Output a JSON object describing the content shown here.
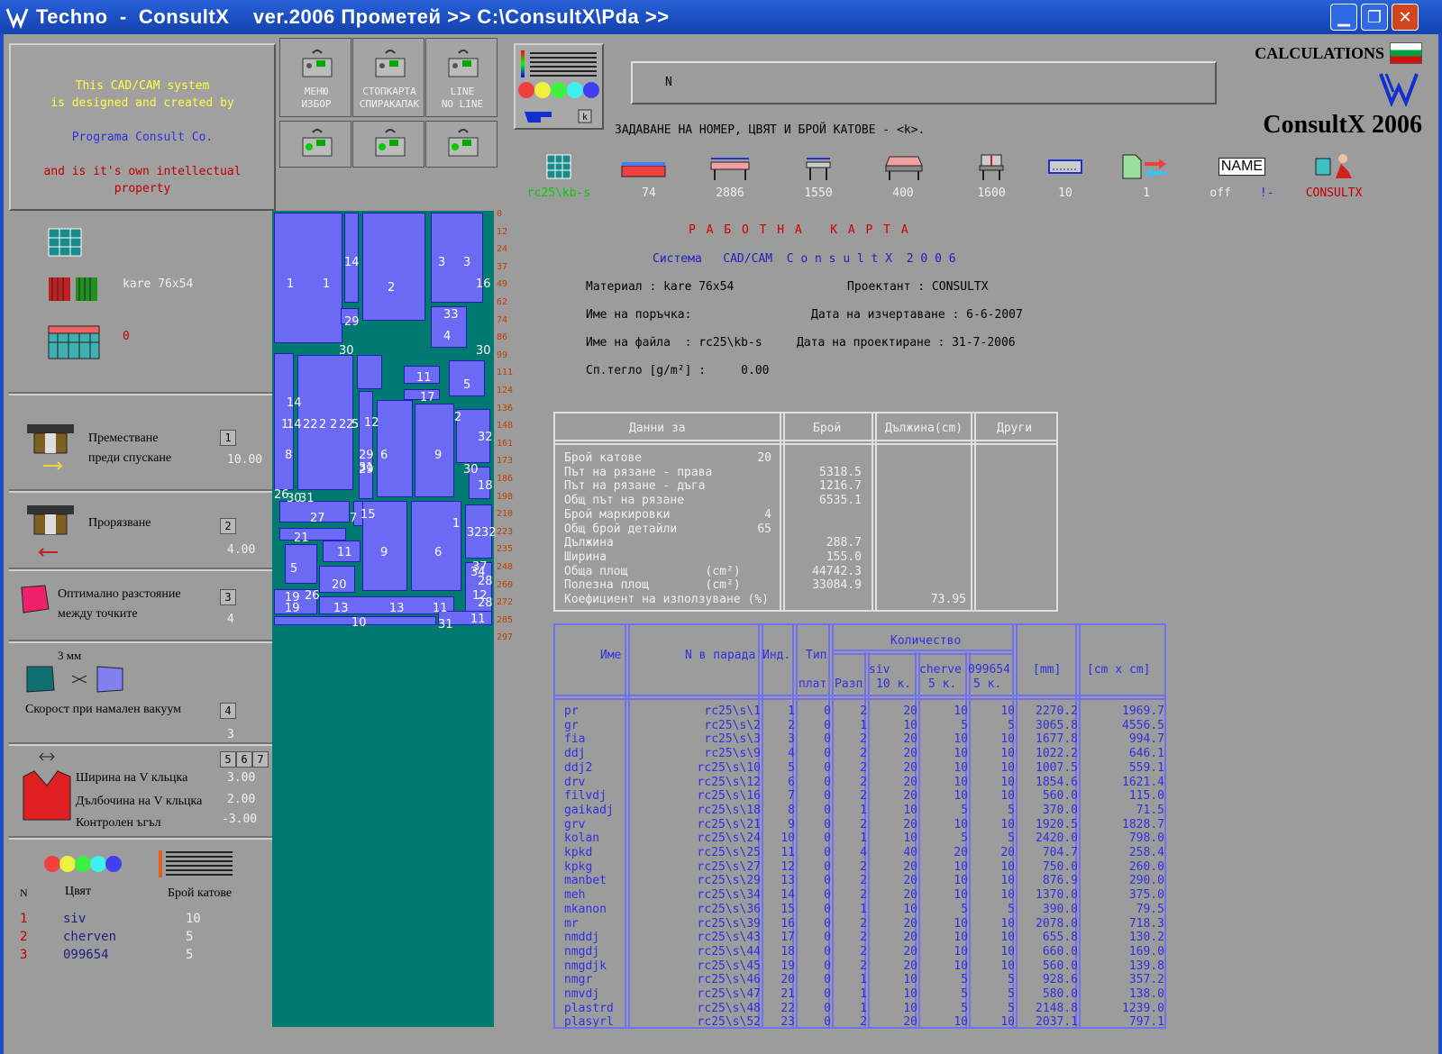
{
  "window": {
    "title": "Techno  -  ConsultX    ver.2006 Прометей >> C:\\ConsultX\\Pda >>",
    "buttons": {
      "minimize": "▁",
      "restore": "❐",
      "close": "✕"
    }
  },
  "info": {
    "line1": "This CAD/CAM system",
    "line2": "is designed and created by",
    "line3": "Programa Consult Co.",
    "line4": "and is it's own  intellectual",
    "line5": "property"
  },
  "controls": [
    {
      "label1": "МЕНЮ",
      "label2": "ИЗБОР"
    },
    {
      "label1": "СТОПКАРТА",
      "label2": "СПИРАКАПАК"
    },
    {
      "label1": "LINE",
      "label2": "NO LINE"
    },
    {
      "label1": "",
      "label2": ""
    },
    {
      "label1": "",
      "label2": ""
    },
    {
      "label1": "",
      "label2": ""
    }
  ],
  "command": {
    "value": "N",
    "hint": "ЗАДАВАНЕ НА НОМЕР, ЦВЯТ И БРОЙ КАТОВЕ - <k>."
  },
  "header": {
    "calc_label": "CALCULATIONS",
    "brand": "ConsultX 2006"
  },
  "toolbar": [
    {
      "icon": "grid-icon",
      "value": "rc25\\kb-s",
      "color": "#00d000"
    },
    {
      "icon": "speed-icon",
      "value": "74",
      "color": "#f0f0f0",
      "scale": "0  50  100 %"
    },
    {
      "icon": "table-length-icon",
      "value": "2886",
      "color": "#f0f0f0"
    },
    {
      "icon": "table-width-icon",
      "value": "1550",
      "color": "#f0f0f0"
    },
    {
      "icon": "layers-icon",
      "value": "400",
      "color": "#f0f0f0"
    },
    {
      "icon": "table-height-icon",
      "value": "1600",
      "color": "#f0f0f0"
    },
    {
      "icon": "border-icon",
      "value": "10",
      "color": "#f0f0f0"
    },
    {
      "icon": "transfer-icon",
      "value": "1",
      "color": "#f0f0f0"
    },
    {
      "icon": "name-icon",
      "value": "off",
      "color": "#f0f0f0",
      "name_text": "NAME",
      "extra": "!-"
    },
    {
      "icon": "consultx-icon",
      "value": "CONSULTX",
      "color": "#c00000"
    }
  ],
  "left": {
    "material": "kare 76x54",
    "layer_count": "0",
    "sections": [
      {
        "label1": "Преместване",
        "label2": "преди спускане",
        "badge": "1",
        "value": "10.00"
      },
      {
        "label1": "Прорязване",
        "label2": "",
        "badge": "2",
        "value": "4.00"
      },
      {
        "label1": "Оптимално разстояние",
        "label2": "между точките",
        "badge": "3",
        "value": "4"
      },
      {
        "label1": "Скорост при намален вакуум",
        "label2": "3 мм",
        "badge": "4",
        "value": "3"
      }
    ],
    "vcut": {
      "badges": [
        "5",
        "6",
        "7"
      ],
      "rows": [
        {
          "label": "Ширина на V кльцка",
          "value": "3.00"
        },
        {
          "label": "Дълбочина на V кльцка",
          "value": "2.00"
        },
        {
          "label": "Контролен ъгъл",
          "value": "-3.00"
        }
      ]
    },
    "colors_header": {
      "n": "N",
      "color": "Цвят",
      "count": "Брой катове"
    },
    "colors": [
      {
        "n": "1",
        "name": "siv",
        "count": "10"
      },
      {
        "n": "2",
        "name": "cherven",
        "count": "5"
      },
      {
        "n": "3",
        "name": "099654",
        "count": "5"
      }
    ]
  },
  "ruler": [
    "0",
    "12",
    "24",
    "37",
    "49",
    "62",
    "74",
    "86",
    "99",
    "111",
    "124",
    "136",
    "148",
    "161",
    "173",
    "186",
    "198",
    "210",
    "223",
    "235",
    "248",
    "260",
    "272",
    "285",
    "297"
  ],
  "layout_labels": [
    "1",
    "1",
    "14",
    "2",
    "3",
    "3",
    "16",
    "29",
    "33",
    "4",
    "30",
    "30",
    "14",
    "11",
    "5",
    "17",
    "14",
    "1",
    "22",
    "2",
    "2",
    "22",
    "5",
    "12",
    "2",
    "29",
    "6",
    "9",
    "32",
    "8",
    "29",
    "31",
    "30",
    "18",
    "26",
    "30",
    "31",
    "7",
    "15",
    "27",
    "1",
    "32",
    "32",
    "21",
    "11",
    "9",
    "6",
    "5",
    "20",
    "37",
    "34",
    "28",
    "12",
    "28",
    "19",
    "26",
    "19",
    "13",
    "13",
    "11",
    "10",
    "31",
    "11"
  ],
  "doc": {
    "title": "Р А Б О Т Н А   К А Р Т А",
    "subtitle": "Система   CAD/CAM  C o n s u l t X  2 0 0 6",
    "material": "Материал : kare 76x54",
    "designer": "Проектант : CONSULTX",
    "order": "Име на поръчка:",
    "draw_date": "Дата на изчертаване : 6-6-2007",
    "file": "Име на файла  : rc25\\kb-s",
    "design_date": "Дата на проектиране : 31-7-2006",
    "weight": "Сп.тегло [g/m²] :     0.00"
  },
  "summary": {
    "headers": [
      "Данни за",
      "Брой",
      "Дължина(cm)",
      "Други"
    ],
    "rows": [
      [
        "Брой катове",
        "20",
        "",
        ""
      ],
      [
        "Път на рязане - права",
        "",
        "5318.5",
        ""
      ],
      [
        "Път на рязане - дъга",
        "",
        "1216.7",
        ""
      ],
      [
        "Общ път на рязане",
        "",
        "6535.1",
        ""
      ],
      [
        "Брой маркировки",
        "4",
        "",
        ""
      ],
      [
        "Общ брой детайли",
        "65",
        "",
        ""
      ],
      [
        "Дължина",
        "",
        "288.7",
        ""
      ],
      [
        "Ширина",
        "",
        "155.0",
        ""
      ],
      [
        "Обща площ           (cm²)",
        "",
        "44742.3",
        ""
      ],
      [
        "Полезна площ        (cm²)",
        "",
        "33084.9",
        ""
      ],
      [
        "Коефициент на използуване (%)",
        "",
        "",
        "73.95"
      ]
    ]
  },
  "parts": {
    "headers": {
      "name": "Име",
      "n": "N в парада",
      "ind": "Инд.",
      "type1": "Тип",
      "type2": "плат",
      "qty": "Количество",
      "razp": "Разп",
      "siv1": "siv",
      "siv2": "10 к.",
      "ch1": "cherve",
      "ch2": "5 к.",
      "c3a": "099654",
      "c3b": "5 к.",
      "mm": "[mm]",
      "cm": "[cm x cm]"
    },
    "rows": [
      [
        "pr",
        "rc25\\s\\1",
        "1",
        "0",
        "2",
        "20",
        "10",
        "10",
        "2270.2",
        "1969.7"
      ],
      [
        "gr",
        "rc25\\s\\2",
        "2",
        "0",
        "1",
        "10",
        "5",
        "5",
        "3065.8",
        "4556.5"
      ],
      [
        "fia",
        "rc25\\s\\3",
        "3",
        "0",
        "2",
        "20",
        "10",
        "10",
        "1677.8",
        "994.7"
      ],
      [
        "ddj",
        "rc25\\s\\9",
        "4",
        "0",
        "2",
        "20",
        "10",
        "10",
        "1022.2",
        "646.1"
      ],
      [
        "ddj2",
        "rc25\\s\\10",
        "5",
        "0",
        "2",
        "20",
        "10",
        "10",
        "1007.5",
        "559.1"
      ],
      [
        "drv",
        "rc25\\s\\12",
        "6",
        "0",
        "2",
        "20",
        "10",
        "10",
        "1854.6",
        "1621.4"
      ],
      [
        "filvdj",
        "rc25\\s\\16",
        "7",
        "0",
        "2",
        "20",
        "10",
        "10",
        "560.0",
        "115.0"
      ],
      [
        "gaikadj",
        "rc25\\s\\18",
        "8",
        "0",
        "1",
        "10",
        "5",
        "5",
        "370.0",
        "71.5"
      ],
      [
        "grv",
        "rc25\\s\\21",
        "9",
        "0",
        "2",
        "20",
        "10",
        "10",
        "1920.5",
        "1828.7"
      ],
      [
        "kolan",
        "rc25\\s\\24",
        "10",
        "0",
        "1",
        "10",
        "5",
        "5",
        "2420.0",
        "798.0"
      ],
      [
        "kpkd",
        "rc25\\s\\25",
        "11",
        "0",
        "4",
        "40",
        "20",
        "20",
        "704.7",
        "258.4"
      ],
      [
        "kpkg",
        "rc25\\s\\27",
        "12",
        "0",
        "2",
        "20",
        "10",
        "10",
        "750.0",
        "260.0"
      ],
      [
        "manbet",
        "rc25\\s\\29",
        "13",
        "0",
        "2",
        "20",
        "10",
        "10",
        "876.9",
        "290.0"
      ],
      [
        "meh",
        "rc25\\s\\34",
        "14",
        "0",
        "2",
        "20",
        "10",
        "10",
        "1370.0",
        "375.0"
      ],
      [
        "mkanon",
        "rc25\\s\\36",
        "15",
        "0",
        "1",
        "10",
        "5",
        "5",
        "390.0",
        "79.5"
      ],
      [
        "mr",
        "rc25\\s\\39",
        "16",
        "0",
        "2",
        "20",
        "10",
        "10",
        "2078.0",
        "718.3"
      ],
      [
        "nmddj",
        "rc25\\s\\43",
        "17",
        "0",
        "2",
        "20",
        "10",
        "10",
        "655.8",
        "130.2"
      ],
      [
        "nmgdj",
        "rc25\\s\\44",
        "18",
        "0",
        "2",
        "20",
        "10",
        "10",
        "660.0",
        "169.0"
      ],
      [
        "nmgdjk",
        "rc25\\s\\45",
        "19",
        "0",
        "2",
        "20",
        "10",
        "10",
        "560.0",
        "139.8"
      ],
      [
        "nmgr",
        "rc25\\s\\46",
        "20",
        "0",
        "1",
        "10",
        "5",
        "5",
        "928.6",
        "357.2"
      ],
      [
        "nmvdj",
        "rc25\\s\\47",
        "21",
        "0",
        "1",
        "10",
        "5",
        "5",
        "580.0",
        "138.0"
      ],
      [
        "plastrd",
        "rc25\\s\\48",
        "22",
        "0",
        "1",
        "10",
        "5",
        "5",
        "2148.8",
        "1239.0"
      ],
      [
        "plasyrl",
        "rc25\\s\\52",
        "23",
        "0",
        "2",
        "20",
        "10",
        "10",
        "2037.1",
        "797.1"
      ]
    ]
  }
}
